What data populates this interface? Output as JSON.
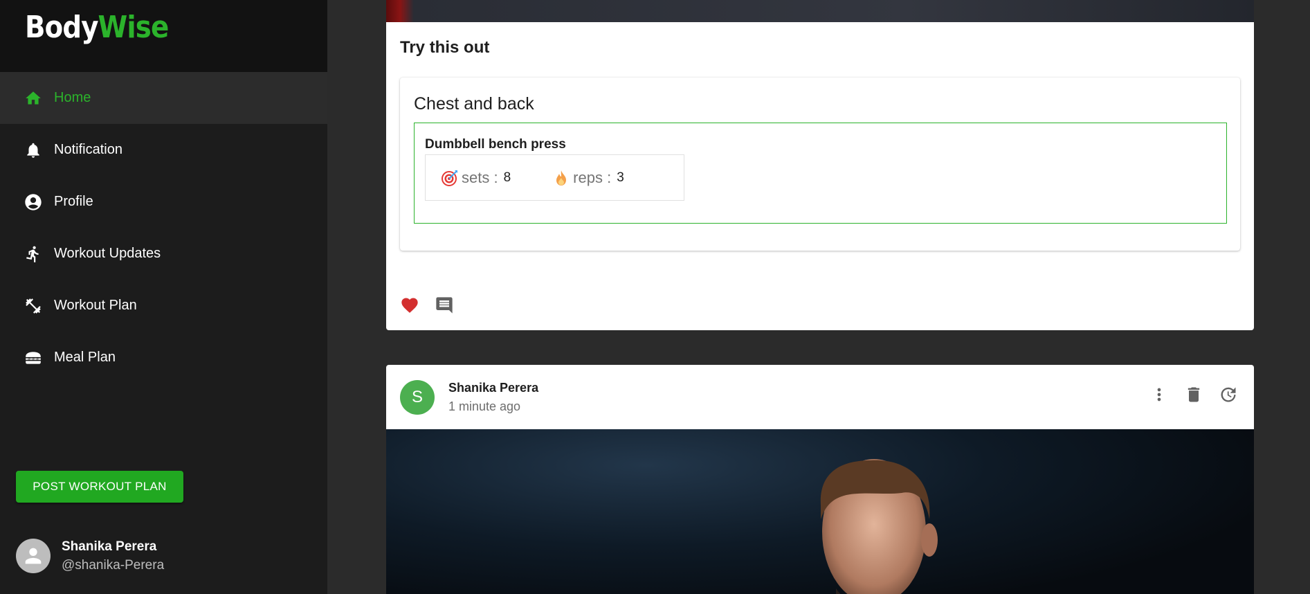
{
  "brand": {
    "part1": "Body",
    "part2": "Wise"
  },
  "nav": {
    "items": [
      {
        "label": "Home",
        "icon": "home-icon",
        "active": true
      },
      {
        "label": "Notification",
        "icon": "bell-icon"
      },
      {
        "label": "Profile",
        "icon": "account-circle-icon"
      },
      {
        "label": "Workout Updates",
        "icon": "running-icon"
      },
      {
        "label": "Workout Plan",
        "icon": "dumbbell-icon"
      },
      {
        "label": "Meal Plan",
        "icon": "burger-icon"
      }
    ]
  },
  "sidebar": {
    "post_button": "POST WORKOUT PLAN",
    "user": {
      "name": "Shanika Perera",
      "handle": "@shanika-Perera"
    }
  },
  "post1": {
    "heading": "Try this out",
    "plan_title": "Chest and back",
    "exercise": {
      "name": "Dumbbell bench press",
      "sets_label": "sets :",
      "sets": "8",
      "reps_label": "reps :",
      "reps": "3"
    }
  },
  "post2": {
    "avatar_letter": "S",
    "author": "Shanika Perera",
    "time": "1 minute ago"
  },
  "colors": {
    "brand_green": "#2bb32b",
    "like_red": "#d32f2f",
    "sidebar_bg": "#1c1c1c"
  }
}
